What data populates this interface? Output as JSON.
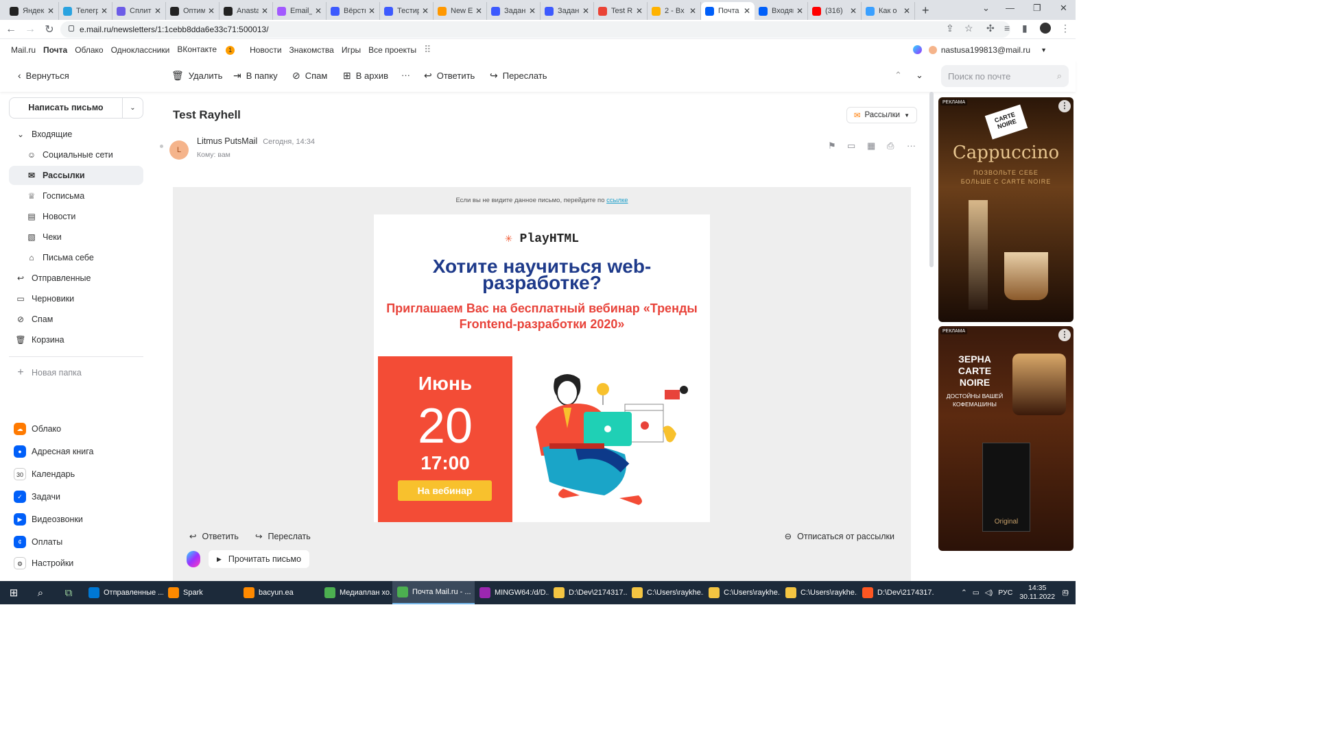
{
  "browser": {
    "tabs": [
      {
        "title": "Яндекс",
        "color": "#222"
      },
      {
        "title": "Телеграм",
        "color": "#2aa3e0"
      },
      {
        "title": "Сплит",
        "color": "#6c5ce7"
      },
      {
        "title": "Оптимизация",
        "color": "#222"
      },
      {
        "title": "Anastasia",
        "color": "#222"
      },
      {
        "title": "Email_",
        "color": "#a259ff"
      },
      {
        "title": "Вёрстка",
        "color": "#3d5afe"
      },
      {
        "title": "Тестирование",
        "color": "#3d5afe"
      },
      {
        "title": "New E",
        "color": "#ff9800"
      },
      {
        "title": "Задание",
        "color": "#3d5afe"
      },
      {
        "title": "Задание",
        "color": "#3d5afe"
      },
      {
        "title": "Test R",
        "color": "#ea4335"
      },
      {
        "title": "2 - Вх",
        "color": "#ffb300"
      },
      {
        "title": "Почта",
        "color": "#005ff9",
        "active": true
      },
      {
        "title": "Входящие",
        "color": "#005ff9"
      },
      {
        "title": "(316)",
        "color": "#ff0000"
      },
      {
        "title": "Как о",
        "color": "#3aa0ff"
      }
    ],
    "url": "e.mail.ru/newsletters/1:1cebb8dda6e33c71:500013/"
  },
  "portal": {
    "links": [
      "Mail.ru",
      "Почта",
      "Облако",
      "Одноклассники",
      "ВКонтакте",
      "Новости",
      "Знакомства",
      "Игры",
      "Все проекты"
    ],
    "vk_badge": "1",
    "user": "nastusa199813@mail.ru"
  },
  "toolbar": {
    "back": "Вернуться",
    "delete": "Удалить",
    "to_folder": "В папку",
    "spam": "Спам",
    "archive": "В архив",
    "more": "···",
    "reply": "Ответить",
    "forward": "Переслать",
    "search_placeholder": "Поиск по почте"
  },
  "sidebar": {
    "compose": "Написать письмо",
    "folders": [
      {
        "label": "Входящие",
        "icon": "⌄"
      },
      {
        "label": "Социальные сети",
        "icon": "☺"
      },
      {
        "label": "Рассылки",
        "icon": "✉",
        "selected": true
      },
      {
        "label": "Госписьма",
        "icon": "♕"
      },
      {
        "label": "Новости",
        "icon": "▤"
      },
      {
        "label": "Чеки",
        "icon": "▧"
      },
      {
        "label": "Письма себе",
        "icon": "⌂"
      },
      {
        "label": "Отправленные",
        "icon": "↩"
      },
      {
        "label": "Черновики",
        "icon": "▭"
      },
      {
        "label": "Спам",
        "icon": "⊘"
      },
      {
        "label": "Корзина",
        "icon": "🗑"
      }
    ],
    "new_folder": "Новая папка",
    "apps": [
      {
        "label": "Облако",
        "color": "#ff7a00",
        "icon": "☁"
      },
      {
        "label": "Адресная книга",
        "color": "#005ff9",
        "icon": "●"
      },
      {
        "label": "Календарь",
        "color": "#ffffff",
        "icon": "30"
      },
      {
        "label": "Задачи",
        "color": "#005ff9",
        "icon": "✓"
      },
      {
        "label": "Видеозвонки",
        "color": "#005ff9",
        "icon": "▶"
      },
      {
        "label": "Оплаты",
        "color": "#005ff9",
        "icon": "¢"
      },
      {
        "label": "Настройки",
        "color": "#ffffff",
        "icon": "⚙"
      }
    ]
  },
  "message": {
    "subject": "Test Rayhell",
    "category": "Рассылки",
    "avatar_letter": "L",
    "sender": "Litmus PutsMail",
    "date": "Сегодня, 14:34",
    "to": "Кому: вам",
    "email": {
      "preheader": "Если вы не видите данное письмо, перейдите по",
      "preheader_link": "ссылке",
      "logo": "PlayHTML",
      "headline": "Хотите научиться web-разработке?",
      "subheadline": "Приглашаем Вас на бесплатный вебинар «Тренды Frontend-разработки 2020»",
      "month": "Июнь",
      "day": "20",
      "time": "17:00",
      "cta": "На вебинар"
    },
    "footer": {
      "reply": "Ответить",
      "forward": "Переслать",
      "unsubscribe": "Отписаться от рассылки",
      "read_aloud": "Прочитать письмо"
    }
  },
  "ads": [
    {
      "label": "РЕКЛАМА",
      "brand": "CARTE NOIRE",
      "title": "Cappuccino",
      "text": "ПОЗВОЛЬТЕ СЕБЕ БОЛЬШЕ С CARTE NOIRE"
    },
    {
      "label": "РЕКЛАМА",
      "brand": "CARTE NOIRE",
      "title": "ЗЕРНА CARTE NOIRE",
      "text": "ДОСТОЙНЫ ВАШЕЙ КОФЕМАШИНЫ",
      "product": "Original"
    }
  ],
  "taskbar": {
    "items": [
      {
        "label": "Отправленные ...",
        "color": "#0078d4"
      },
      {
        "label": "Spark",
        "color": "#ff8a00"
      },
      {
        "label": "bacyun.ea",
        "color": "#ff8a00"
      },
      {
        "label": "Медиаплан хо...",
        "color": "#4caf50"
      },
      {
        "label": "Почта Mail.ru - ...",
        "color": "#4caf50",
        "active": true
      },
      {
        "label": "MINGW64:/d/D...",
        "color": "#9c27b0"
      },
      {
        "label": "D:\\Dev\\2174317...",
        "color": "#f4c542"
      },
      {
        "label": "C:\\Users\\raykhe...",
        "color": "#f4c542"
      },
      {
        "label": "C:\\Users\\raykhe...",
        "color": "#f4c542"
      },
      {
        "label": "C:\\Users\\raykhe...",
        "color": "#f4c542"
      },
      {
        "label": "D:\\Dev\\2174317...",
        "color": "#ff5722"
      }
    ],
    "lang": "РУС",
    "time": "14:35",
    "date": "30.11.2022",
    "notif": "43"
  }
}
